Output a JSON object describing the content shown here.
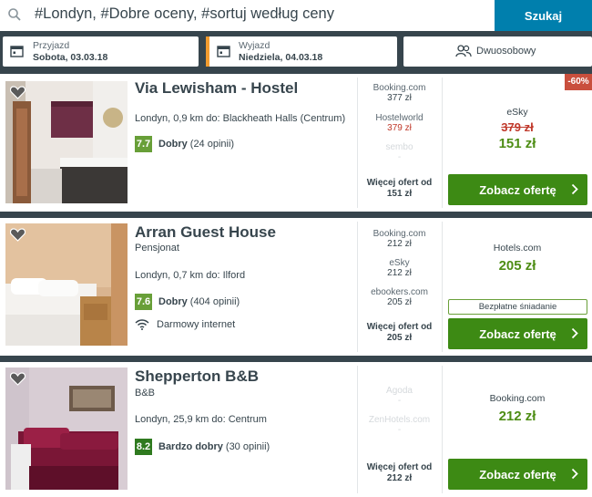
{
  "search": {
    "query": "#Londyn, #Dobre oceny, #sortuj według ceny",
    "button_label": "Szukaj"
  },
  "checkin": {
    "label": "Przyjazd",
    "value": "Sobota, 03.03.18"
  },
  "checkout": {
    "label": "Wyjazd",
    "value": "Niedziela, 04.03.18"
  },
  "room": {
    "value": "Dwuosobowy"
  },
  "colors": {
    "accent": "#007fad",
    "cta": "#3d8a14",
    "checkout_bar": "#f39c2f",
    "discount_badge": "#c94f3d"
  },
  "hotels": [
    {
      "name": "Via Lewisham - Hostel",
      "type": "",
      "distance": "Londyn, 0,9 km do: Blackheath Halls (Centrum)",
      "score": "7.7",
      "rating_label": "Dobry",
      "reviews": "(24 opinii)",
      "amenity": "",
      "offers": [
        {
          "site": "Booking.com",
          "price": "377 zł"
        },
        {
          "site": "Hostelworld",
          "price": "379 zł"
        },
        {
          "site": "sembo",
          "price": "-"
        }
      ],
      "more_offers": "Więcej ofert od",
      "more_price": "151 zł",
      "deal_site": "eSky",
      "deal_old_price": "379 zł",
      "deal_price": "151 zł",
      "discount": "-60%",
      "cta": "Zobacz ofertę"
    },
    {
      "name": "Arran Guest House",
      "type": "Pensjonat",
      "distance": "Londyn, 0,7 km do: Ilford",
      "score": "7.6",
      "rating_label": "Dobry",
      "reviews": "(404 opinii)",
      "amenity": "Darmowy internet",
      "offers": [
        {
          "site": "Booking.com",
          "price": "212 zł"
        },
        {
          "site": "eSky",
          "price": "212 zł"
        },
        {
          "site": "ebookers.com",
          "price": "205 zł"
        }
      ],
      "more_offers": "Więcej ofert od",
      "more_price": "205 zł",
      "deal_site": "Hotels.com",
      "deal_price": "205 zł",
      "perk": "Bezpłatne śniadanie",
      "cta": "Zobacz ofertę"
    },
    {
      "name": "Shepperton B&B",
      "type": "B&B",
      "distance": "Londyn, 25,9 km do: Centrum",
      "score": "8.2",
      "rating_label": "Bardzo dobry",
      "reviews": "(30 opinii)",
      "amenity": "",
      "offers": [
        {
          "site": "Agoda",
          "price": "-"
        },
        {
          "site": "ZenHotels.com",
          "price": "-"
        }
      ],
      "more_offers": "Więcej ofert od",
      "more_price": "212 zł",
      "deal_site": "Booking.com",
      "deal_price": "212 zł",
      "cta": "Zobacz ofertę"
    }
  ]
}
